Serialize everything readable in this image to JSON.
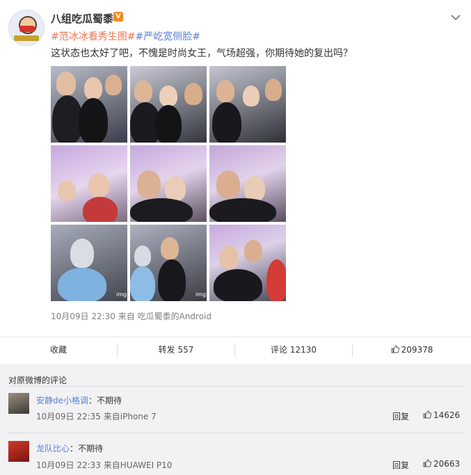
{
  "post": {
    "username": "八组吃瓜蜀黍",
    "verified_badge": "V",
    "hashtags": [
      "#范冰冰看秀生图#",
      "#严屹宽侧脸#"
    ],
    "content": "这状态也太好了吧，不愧是时尚女王，气场超强，你期待她的复出吗？",
    "date": "10月09日 22:30",
    "source_prefix": "来自",
    "source": "吃瓜蜀黍的Android",
    "images": [
      "photo",
      "photo",
      "photo",
      "photo",
      "photo",
      "photo",
      "photo",
      "photo",
      "photo"
    ],
    "image_watermark": "img"
  },
  "actions": {
    "favorite": "收藏",
    "repost_label": "转发",
    "repost_count": "557",
    "comment_label": "评论",
    "comment_count": "12130",
    "like_count": "209378"
  },
  "comments": {
    "section_title": "对原微博的评论",
    "items": [
      {
        "name": "安静de小格调",
        "separator": "：",
        "text": "不期待",
        "time": "10月09日 22:35",
        "source": "来自iPhone 7",
        "reply": "回复",
        "likes": "14626"
      },
      {
        "name": "龙队比心",
        "separator": "：",
        "text": "不期待",
        "time": "10月09日 22:33",
        "source": "来自HUAWEI P10",
        "reply": "回复",
        "likes": "20663"
      }
    ]
  },
  "colors": {
    "hashtag_1": "#eb7350",
    "hashtag_2": "#5b7fd6",
    "username_link": "#5b7fd6",
    "badge": "#f08a24",
    "comments_bg": "#f2f2f5"
  },
  "icons": {
    "chevron": "chevron-down-icon",
    "like": "thumbs-up-icon"
  }
}
